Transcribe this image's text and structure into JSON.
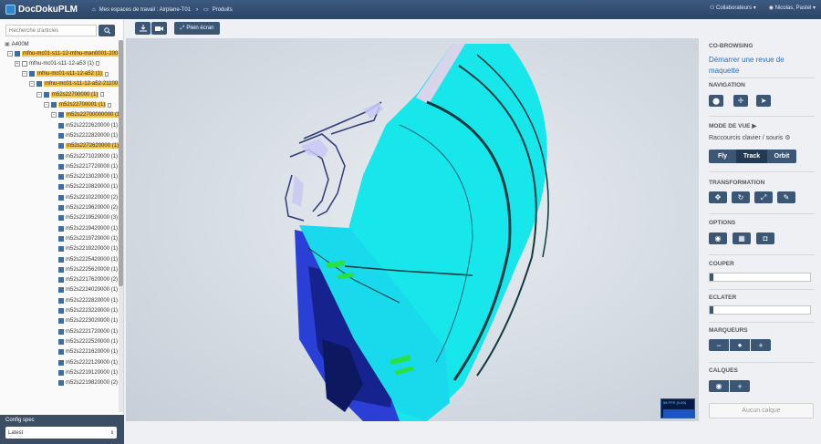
{
  "app": {
    "brand": "DocDokuPLM",
    "brand_main": "DocDoku",
    "brand_suffix": "PLM"
  },
  "breadcrumb": {
    "workspace": "Mes espaces de travail : Airplane-T01",
    "products": "Produits"
  },
  "topbar_right": {
    "collaborators": "Collaborateurs",
    "user": "Nicolas, Pastel"
  },
  "toolbar": {
    "fullscreen": "Plein écran"
  },
  "search": {
    "placeholder": "Recherche d'articles"
  },
  "tree": {
    "root": "A400M",
    "nodes": [
      {
        "label": "mfnu-mc01-s11-12-mfnu-man0001-200",
        "hl": true
      },
      {
        "label": "mfnu-mc01-s11-12-a53 (1)",
        "hl": false
      },
      {
        "label": "mfnu-mc01-s11-12-a52 (1)",
        "hl": true
      },
      {
        "label": "mfnu-mc01-s11-12-a52-21100 (1)",
        "hl": true
      },
      {
        "label": "m52s22700000 (1)",
        "hl": true
      },
      {
        "label": "m52s22700001 (1)",
        "hl": true
      },
      {
        "label": "m52s22700000000 (1)",
        "hl": true
      },
      {
        "label": "m52s2222620000 (1)",
        "hl": false
      },
      {
        "label": "m52s2222820000 (1)",
        "hl": false
      },
      {
        "label": "m52s2272620000 (1)",
        "hl": true
      },
      {
        "label": "m52s2271020000 (1)",
        "hl": false
      },
      {
        "label": "m52s2217720000 (1)",
        "hl": false
      },
      {
        "label": "m52s2213020000 (1)",
        "hl": false
      },
      {
        "label": "m52s2210820000 (1)",
        "hl": false
      },
      {
        "label": "m52s2210220000 (2)",
        "hl": false
      },
      {
        "label": "m52s2219620000 (2)",
        "hl": false
      },
      {
        "label": "m52s2219520000 (3)",
        "hl": false
      },
      {
        "label": "m52s2219420000 (1)",
        "hl": false
      },
      {
        "label": "m52s2219720000 (1)",
        "hl": false
      },
      {
        "label": "m52s2219220000 (1)",
        "hl": false
      },
      {
        "label": "m52s2225420000 (1)",
        "hl": false
      },
      {
        "label": "m52s2225620000 (1)",
        "hl": false
      },
      {
        "label": "m52s2217620000 (2)",
        "hl": false
      },
      {
        "label": "m52s2224020000 (1)",
        "hl": false
      },
      {
        "label": "m52s2222820000 (1)",
        "hl": false
      },
      {
        "label": "m52s2223220000 (1)",
        "hl": false
      },
      {
        "label": "m52s2223020000 (1)",
        "hl": false
      },
      {
        "label": "m52s2221720000 (1)",
        "hl": false
      },
      {
        "label": "m52s2222520000 (1)",
        "hl": false
      },
      {
        "label": "m52s2221620000 (1)",
        "hl": false
      },
      {
        "label": "m52s2222120000 (1)",
        "hl": false
      },
      {
        "label": "m52s2219120000 (1)",
        "hl": false
      },
      {
        "label": "m52s2219820000 (2)",
        "hl": false
      }
    ]
  },
  "config": {
    "title": "Config spec",
    "value": "Latest"
  },
  "viewer": {
    "fps": "58 FPS (0-60)"
  },
  "right": {
    "cobrowsing": "CO-BROWSING",
    "review_link": "Démarrer une revue de maquette",
    "navigation": "NAVIGATION",
    "view_mode": "MODE DE VUE",
    "shortcuts": "Raccourcis clavier / souris",
    "modes": [
      "Fly",
      "Track",
      "Orbit"
    ],
    "transformation": "TRANSFORMATION",
    "options": "OPTIONS",
    "cut": "COUPER",
    "explode": "ECLATER",
    "markers": "MARQUEURS",
    "layers": "CALQUES",
    "no_layer": "Aucun calque"
  },
  "colors": {
    "accent": "#3c5775",
    "topbar": "#2b4566",
    "highlight": "#f5c24a",
    "model_cyan": "#17e6ea",
    "model_blue": "#2a3fd6"
  }
}
